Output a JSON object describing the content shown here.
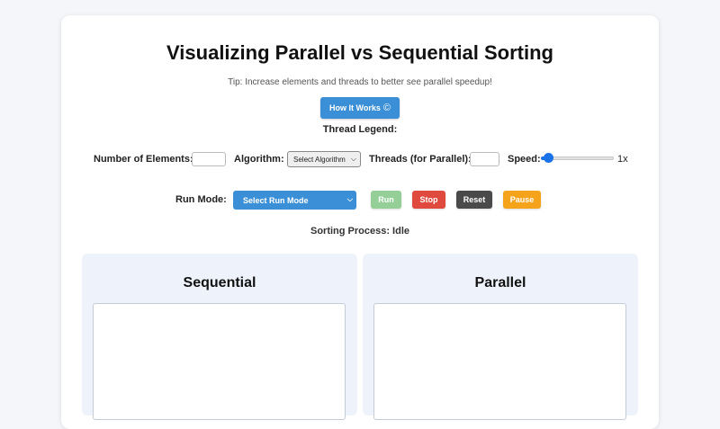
{
  "header": {
    "title": "Visualizing Parallel vs Sequential Sorting",
    "tip": "Tip: Increase elements and threads to better see parallel speedup!",
    "how_it_works_label": "How It Works",
    "how_it_works_icon": "©",
    "legend_title": "Thread Legend:"
  },
  "controls": {
    "elements_label": "Number of Elements:",
    "elements_value": "",
    "algorithm_label": "Algorithm:",
    "algorithm_selected": "Select Algorithm",
    "threads_label": "Threads (for Parallel):",
    "threads_value": "",
    "speed_label": "Speed:",
    "speed_value_text": "1x",
    "speed_fraction": 0.04
  },
  "run": {
    "mode_label": "Run Mode:",
    "mode_selected": "Select Run Mode",
    "run_label": "Run",
    "stop_label": "Stop",
    "reset_label": "Reset",
    "pause_label": "Pause"
  },
  "status": {
    "text": "Sorting Process: Idle"
  },
  "panels": {
    "sequential_title": "Sequential",
    "parallel_title": "Parallel"
  },
  "colors": {
    "primary": "#3b8fd6",
    "run_disabled": "#94cf98",
    "stop": "#e04a3e",
    "reset": "#4a4a4a",
    "pause": "#f5a31a"
  }
}
